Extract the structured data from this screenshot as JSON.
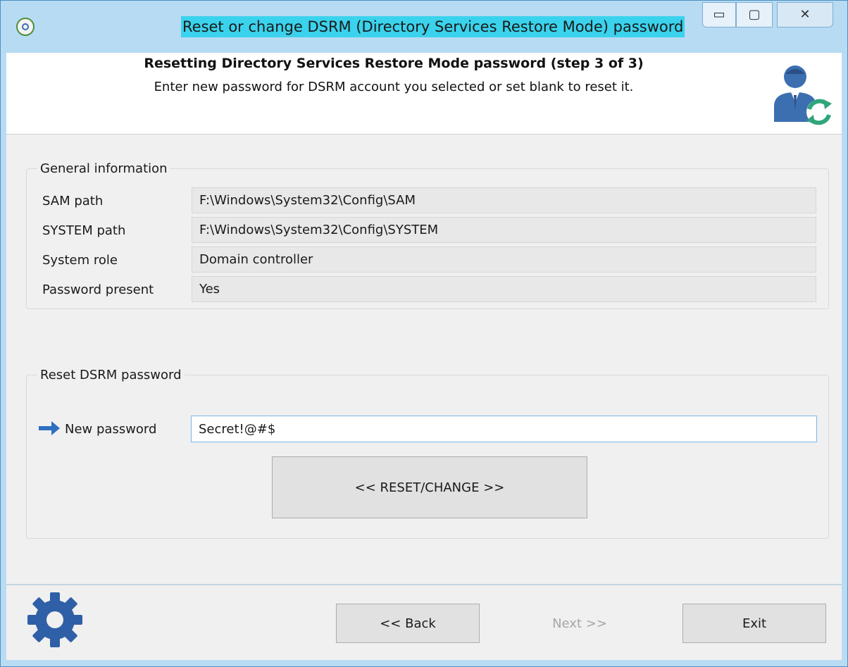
{
  "window": {
    "title": "Reset or change DSRM (Directory Services Restore Mode) password",
    "controls": {
      "minimize": "▭",
      "maximize": "▢",
      "close": "✕"
    }
  },
  "header": {
    "title": "Resetting Directory Services Restore Mode password (step 3 of 3)",
    "subtitle": "Enter new password for DSRM account you selected or set blank to reset it.",
    "icon": "user-refresh-icon"
  },
  "general": {
    "caption": "General information",
    "rows": [
      {
        "label": "SAM path",
        "value": "F:\\Windows\\System32\\Config\\SAM"
      },
      {
        "label": "SYSTEM path",
        "value": "F:\\Windows\\System32\\Config\\SYSTEM"
      },
      {
        "label": "System role",
        "value": "Domain controller"
      },
      {
        "label": "Password present",
        "value": "Yes"
      }
    ]
  },
  "reset": {
    "caption": "Reset DSRM password",
    "new_password_label": "New password",
    "new_password_value": "Secret!@#$",
    "reset_button": "<< RESET/CHANGE >>"
  },
  "footer": {
    "back_button": "<< Back",
    "next_button": "Next >>",
    "exit_button": "Exit",
    "settings_icon": "gear-icon"
  },
  "colors": {
    "title_highlight": "#3ad2ec",
    "icon_blue": "#3b6fb0",
    "icon_green": "#2fa57a",
    "window_frame": "#b9dcf3"
  }
}
